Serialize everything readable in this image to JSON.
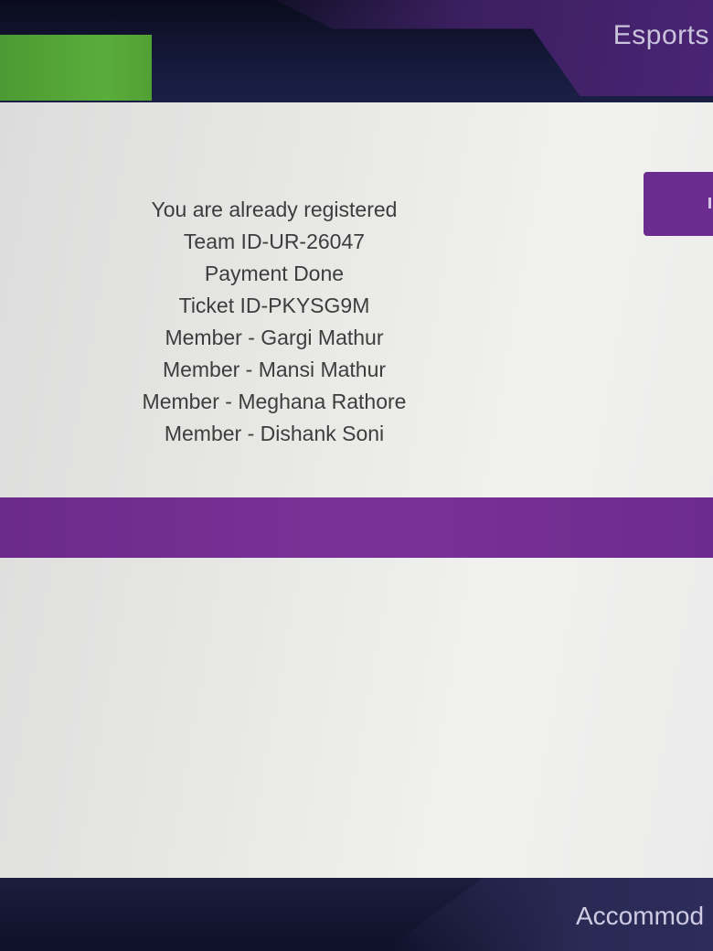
{
  "header": {
    "nav_label": "Esports",
    "nav_label_clipped": "..."
  },
  "registration": {
    "status": "You are already registered",
    "team_id": "Team ID-UR-26047",
    "payment": "Payment Done",
    "ticket_id": "Ticket ID-PKYSG9M",
    "members": [
      "Member - Gargi Mathur",
      "Member - Mansi Mathur",
      "Member - Meghana Rathore",
      "Member - Dishank Soni"
    ]
  },
  "footer": {
    "nav_label": "Accommod"
  },
  "colors": {
    "accent_purple": "#6c2a8c",
    "header_green": "#52a034",
    "dark_navy": "#0d1022"
  }
}
